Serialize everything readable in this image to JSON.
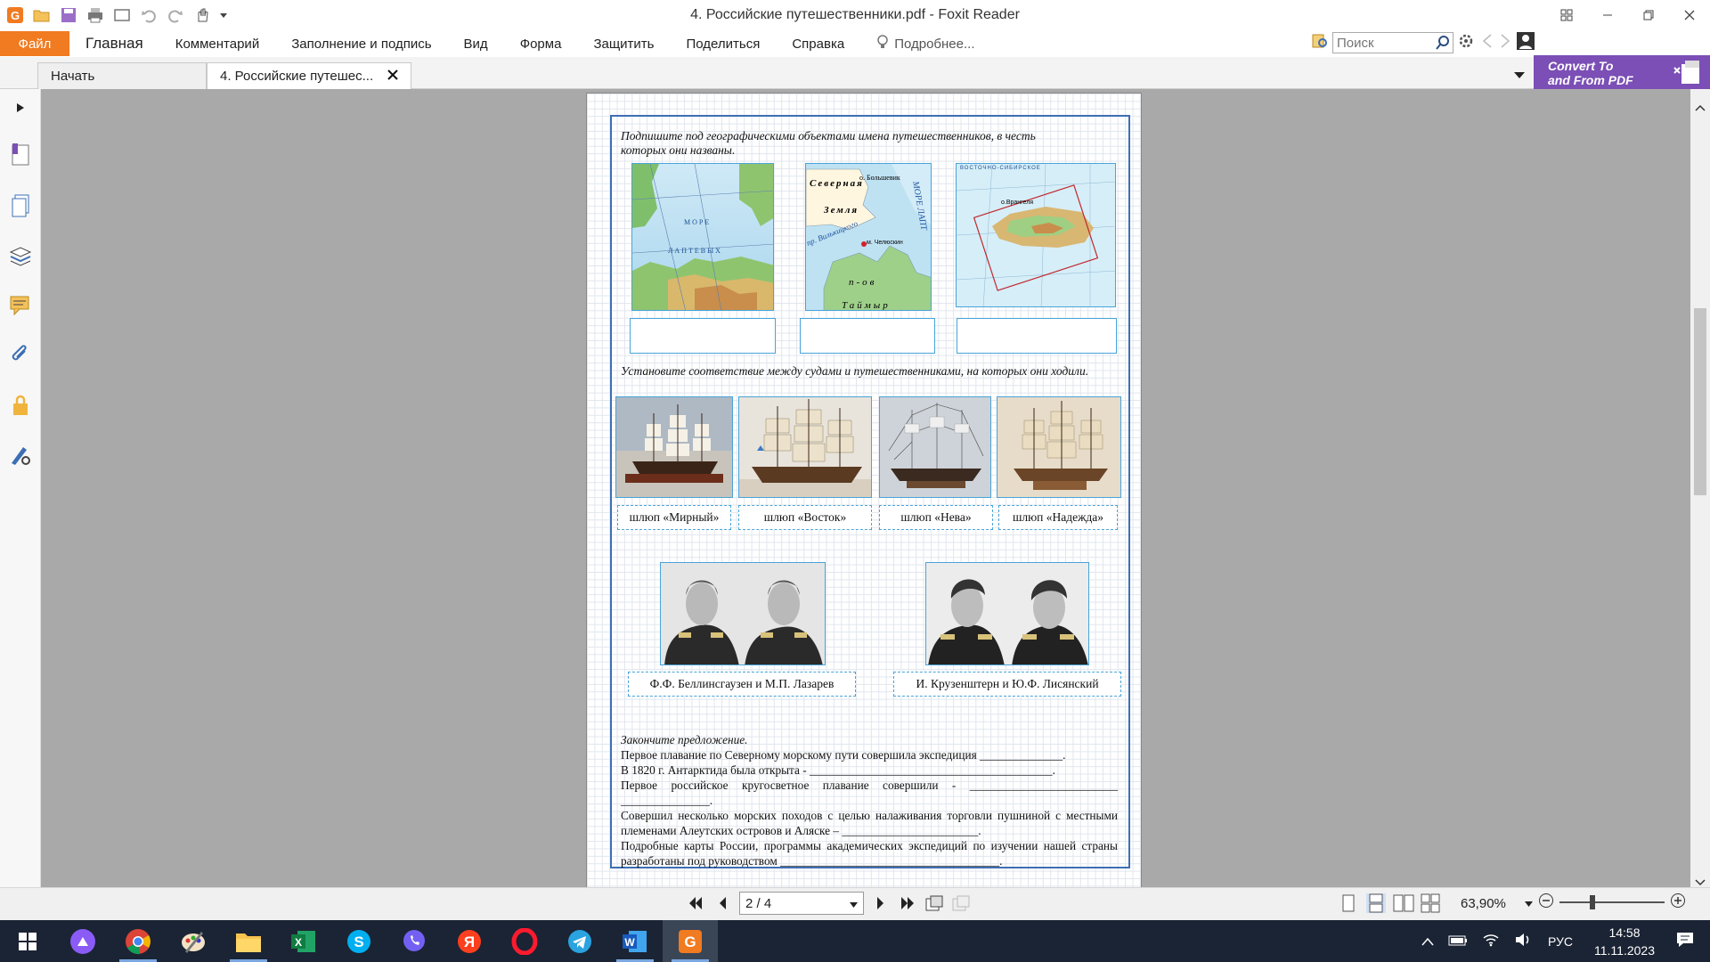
{
  "app": {
    "window_title": "4. Российские путешественники.pdf - Foxit Reader",
    "brand_color": "#f07b21"
  },
  "menu": {
    "file": "Файл",
    "items": [
      "Главная",
      "Комментарий",
      "Заполнение и подпись",
      "Вид",
      "Форма",
      "Защитить",
      "Поделиться",
      "Справка"
    ],
    "tell_me": "Подробнее...",
    "search_placeholder": "Поиск"
  },
  "tabs": [
    {
      "label": "Начать",
      "active": false
    },
    {
      "label": "4. Российские путешес...",
      "active": true
    }
  ],
  "convert_banner": {
    "line1": "Convert To",
    "line2": "and From PDF"
  },
  "document": {
    "task1": "Подпишите под географическими объектами имена путешественников, в честь которых они названы.",
    "maps": [
      {
        "name": "laptev-sea-map",
        "labels": [
          "М О Р Е",
          "Л А П Т Е В Ы Х"
        ]
      },
      {
        "name": "chelyuskin-map",
        "labels": [
          "о. Большевик",
          "Северная",
          "Земля",
          "пр. Вилькицкого",
          "м. Челюскин",
          "п-ов",
          "Таймыр",
          "МОРЕ ЛАПТ"
        ]
      },
      {
        "name": "wrangel-map",
        "labels": [
          "ВОСТОЧНО-СИБИРСКОЕ",
          "о.Врангеля"
        ]
      }
    ],
    "task2": "Установите соответствие между судами и путешественниками, на которых они ходили.",
    "ships": [
      "шлюп «Мирный»",
      "шлюп «Восток»",
      "шлюп «Нева»",
      "шлюп «Надежда»"
    ],
    "travellers": [
      "Ф.Ф. Беллинсгаузен и М.П. Лазарев",
      "И. Крузенштерн и Ю.Ф. Лисянский"
    ],
    "task3_title": "Закончите предложение.",
    "sentences": [
      "Первое плавание по Северному морскому пути совершила экспедиция ______________.",
      "В 1820 г. Антарктида была открыта - _________________________________________.",
      "Первое российское кругосветное плавание совершили - _________________________ _______________.",
      "Совершил несколько морских походов с целью налаживания торговли пушниной с местными племенами Алеутских островов и Аляске – _______________________.",
      "Подробные карты России, программы академических экспедиций по изучении нашей страны разработаны под руководством _____________________________________."
    ]
  },
  "status": {
    "page_indicator": "2 / 4",
    "zoom": "63,90%"
  },
  "taskbar": {
    "apps": [
      "start-icon",
      "alice-icon",
      "chrome-icon",
      "paint-icon",
      "explorer-icon",
      "excel-icon",
      "skype-icon",
      "viber-icon",
      "yandex-icon",
      "opera-icon",
      "telegram-icon",
      "word-icon",
      "foxit-icon"
    ],
    "lang": "РУС",
    "time": "14:58",
    "date": "11.11.2023"
  }
}
